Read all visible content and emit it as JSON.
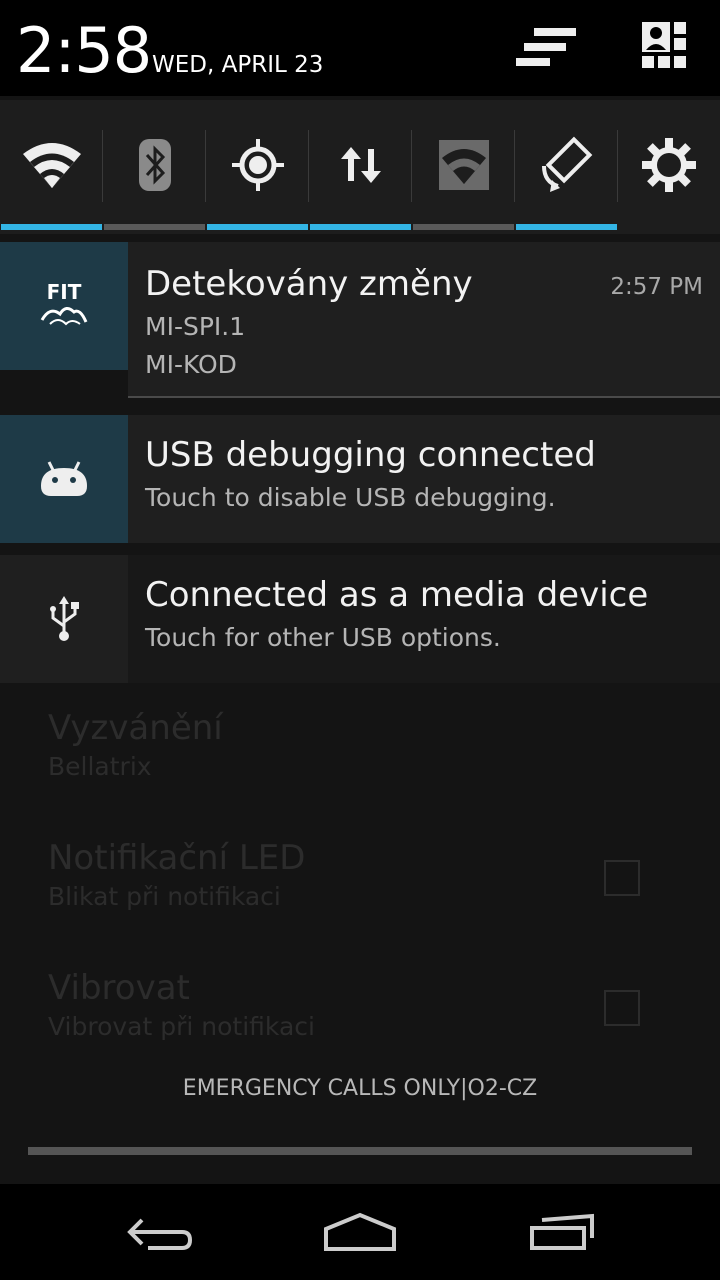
{
  "status": {
    "time": "2:58",
    "date": "WED, APRIL 23"
  },
  "quick_settings": [
    {
      "name": "wifi-icon",
      "active": true
    },
    {
      "name": "bluetooth-icon",
      "active": false
    },
    {
      "name": "location-icon",
      "active": true
    },
    {
      "name": "data-transfer-icon",
      "active": true
    },
    {
      "name": "hotspot-icon",
      "active": false
    },
    {
      "name": "auto-rotate-icon",
      "active": true
    },
    {
      "name": "settings-gear-icon",
      "active": false
    }
  ],
  "notifications": [
    {
      "icon": "fit-logo-icon",
      "title": "Detekovány změny",
      "line1": "MI-SPI.1",
      "line2": "MI-KOD",
      "time": "2:57 PM",
      "logo_text": "FIT"
    },
    {
      "icon": "android-icon",
      "title": "USB debugging connected",
      "text": "Touch to disable USB debugging."
    },
    {
      "icon": "usb-icon",
      "title": "Connected as a media device",
      "text": "Touch for other USB options."
    }
  ],
  "background": {
    "items": [
      {
        "title": "Vyzvánění",
        "sub": "Bellatrix"
      },
      {
        "title": "Notifikační LED",
        "sub": "Blikat při notifikaci"
      },
      {
        "title": "Vibrovat",
        "sub": "Vibrovat při notifikaci"
      }
    ]
  },
  "carrier": "EMERGENCY CALLS ONLY|O2-CZ",
  "colors": {
    "accent": "#33b5e5",
    "icon_tile": "#1e3a47"
  }
}
